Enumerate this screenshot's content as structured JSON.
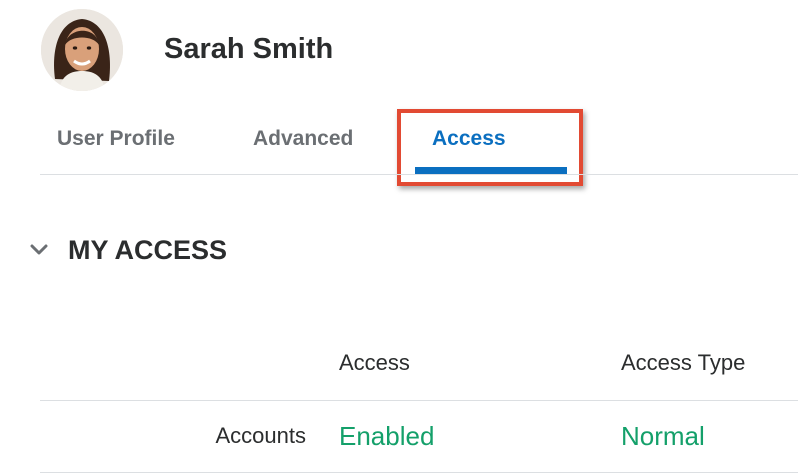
{
  "user": {
    "name": "Sarah Smith",
    "avatar_icon": "user-photo"
  },
  "tabs": [
    {
      "label": "User Profile",
      "active": false
    },
    {
      "label": "Advanced",
      "active": false
    },
    {
      "label": "Access",
      "active": true
    }
  ],
  "section": {
    "title": "MY ACCESS",
    "expanded": true,
    "toggle_icon": "chevron-down-icon"
  },
  "table": {
    "columns": [
      "Access",
      "Access Type"
    ],
    "rows": [
      {
        "label": "Accounts",
        "access": "Enabled",
        "access_type": "Normal"
      }
    ]
  },
  "colors": {
    "active_tab": "#0b6fc0",
    "highlight_box": "#e24a33",
    "value_green": "#14a06a",
    "text_dark": "#2b2d2e",
    "text_muted": "#6b6f73"
  }
}
